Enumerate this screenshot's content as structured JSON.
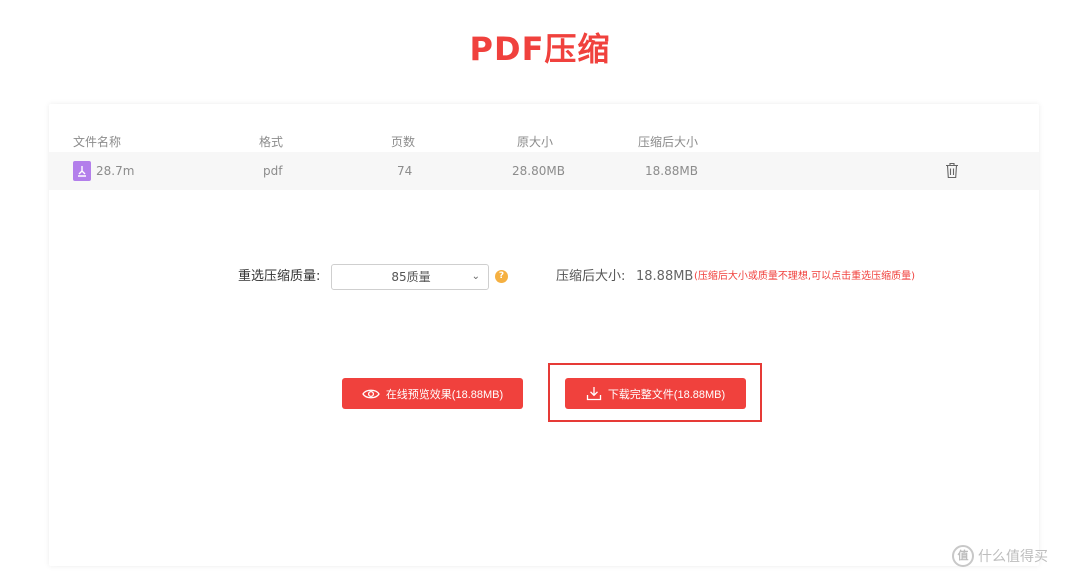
{
  "title": "PDF压缩",
  "table": {
    "headers": [
      "文件名称",
      "格式",
      "页数",
      "原大小",
      "压缩后大小"
    ],
    "rows": [
      {
        "name": "28.7m",
        "format": "pdf",
        "pages": "74",
        "original_size": "28.80MB",
        "compressed_size": "18.88MB"
      }
    ]
  },
  "quality": {
    "label": "重选压缩质量:",
    "selected": "85质量",
    "after_label": "压缩后大小:",
    "after_value": "18.88MB",
    "note": "(压缩后大小或质量不理想,可以点击重选压缩质量)"
  },
  "buttons": {
    "preview": "在线预览效果(18.88MB)",
    "download": "下载完整文件(18.88MB)"
  },
  "watermark": {
    "text": "什么值得买",
    "badge": "值"
  },
  "colors": {
    "accent": "#f0413d",
    "pdf_icon": "#b37feb",
    "help_icon": "#f5b041"
  }
}
